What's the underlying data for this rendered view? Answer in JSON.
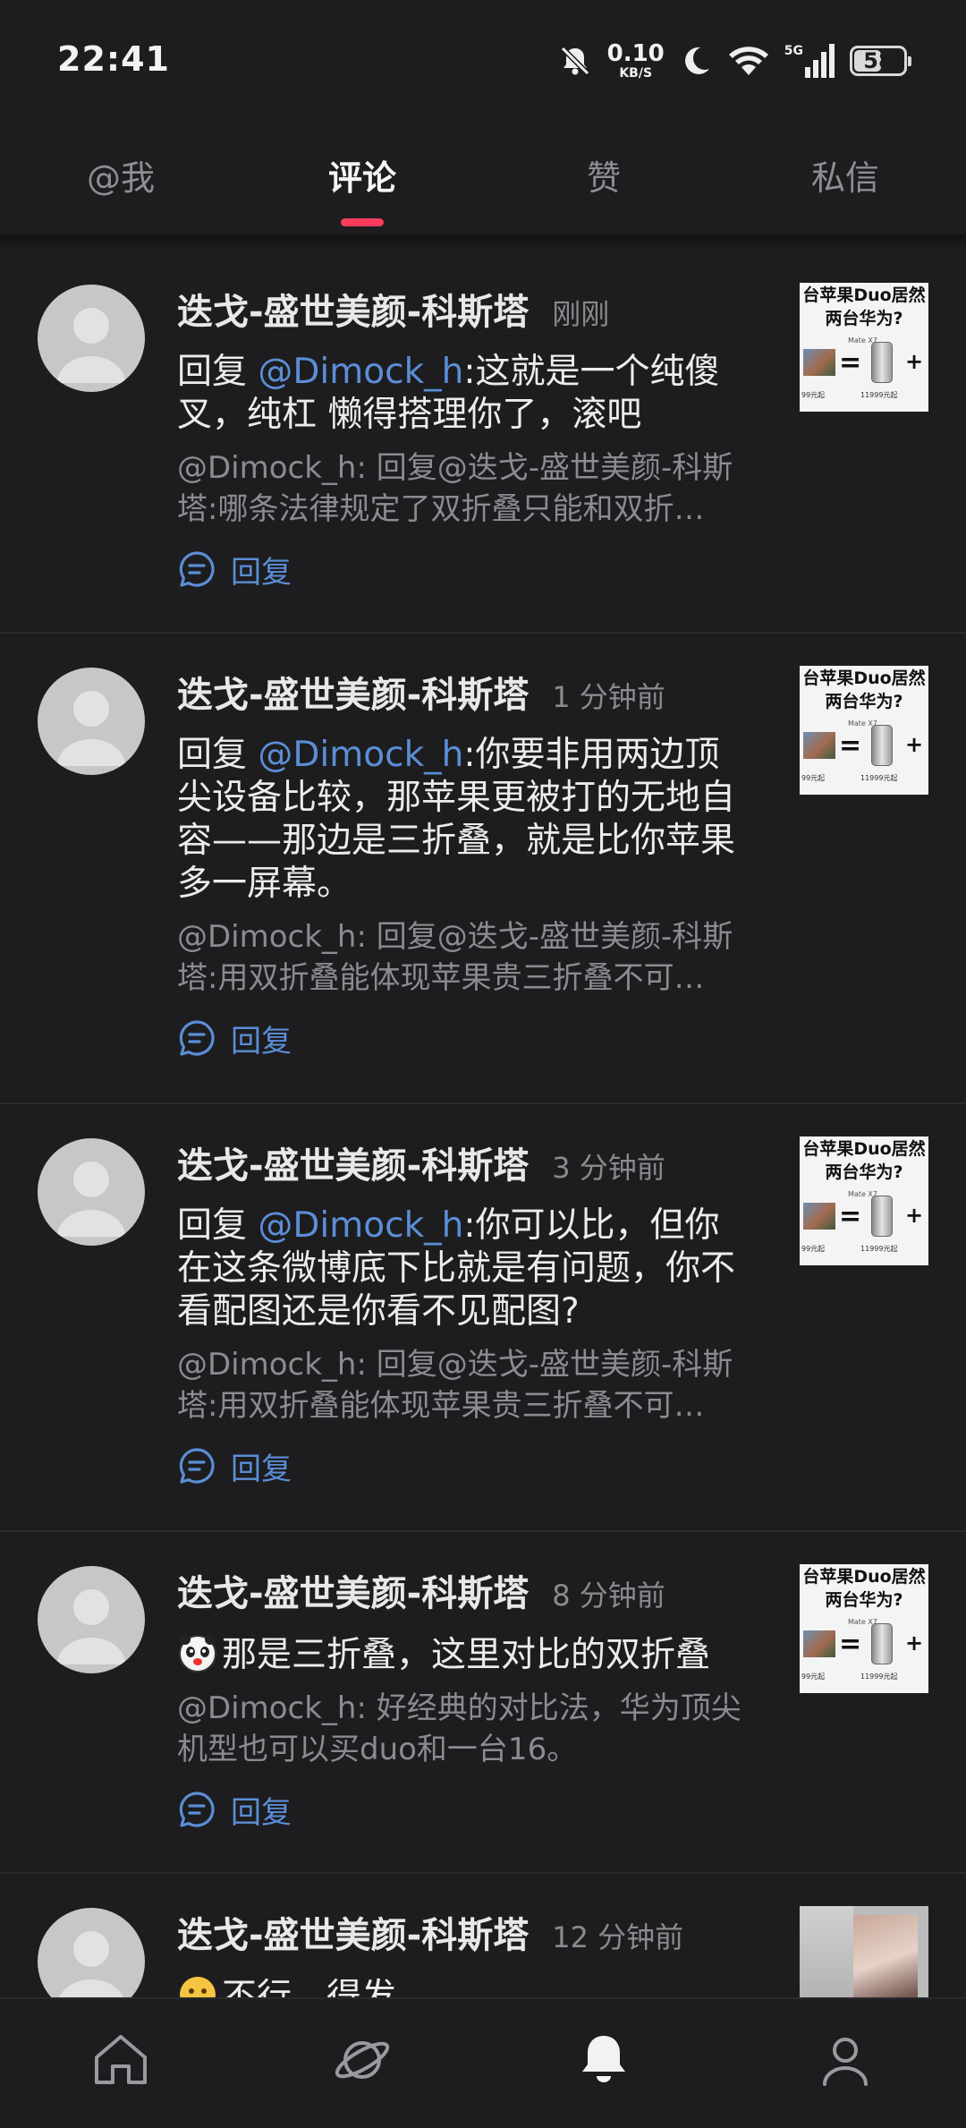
{
  "status_bar": {
    "time": "22:41",
    "net_speed_value": "0.10",
    "net_speed_unit": "KB/S",
    "signal_label": "5G",
    "battery": "58",
    "battery_level_percent": 58,
    "icons": [
      "mute-bell-icon",
      "moon-icon",
      "wifi-icon",
      "signal-icon",
      "battery-icon"
    ]
  },
  "tabs": [
    {
      "label": "@我",
      "active": false
    },
    {
      "label": "评论",
      "active": true
    },
    {
      "label": "赞",
      "active": false
    },
    {
      "label": "私信",
      "active": false
    }
  ],
  "colors": {
    "background": "#1d1d1f",
    "accent_indicator": "#ff3b5c",
    "link_blue": "#5b8ed6",
    "secondary_text": "#8b8b90"
  },
  "comments": [
    {
      "name": "迭戈-盛世美颜-科斯塔",
      "time": "刚刚",
      "reply_prefix": "回复 ",
      "mention": "@Dimock_h",
      "text": ":这就是一个纯傻叉，纯杠 懒得搭理你了，滚吧",
      "quote": "@Dimock_h: 回复@迭戈-盛世美颜-科斯塔:哪条法律规定了双折叠只能和双折…",
      "reply_label": "回复",
      "thumb_line1": "台苹果Duo居然",
      "thumb_line2": "两台华为?",
      "thumb_model": "Mate X7",
      "thumb_price1": "99元起",
      "thumb_price2": "11999元起"
    },
    {
      "name": "迭戈-盛世美颜-科斯塔",
      "time": "1 分钟前",
      "reply_prefix": "回复 ",
      "mention": "@Dimock_h",
      "text": ":你要非用两边顶尖设备比较，那苹果更被打的无地自容——那边是三折叠，就是比你苹果多一屏幕。",
      "quote": "@Dimock_h: 回复@迭戈-盛世美颜-科斯塔:用双折叠能体现苹果贵三折叠不可…",
      "reply_label": "回复",
      "thumb_line1": "台苹果Duo居然",
      "thumb_line2": "两台华为?",
      "thumb_model": "Mate X7",
      "thumb_price1": "99元起",
      "thumb_price2": "11999元起"
    },
    {
      "name": "迭戈-盛世美颜-科斯塔",
      "time": "3 分钟前",
      "reply_prefix": "回复 ",
      "mention": "@Dimock_h",
      "text": ":你可以比，但你在这条微博底下比就是有问题，你不看配图还是你看不见配图?",
      "quote": "@Dimock_h: 回复@迭戈-盛世美颜-科斯塔:用双折叠能体现苹果贵三折叠不可…",
      "reply_label": "回复",
      "thumb_line1": "台苹果Duo居然",
      "thumb_line2": "两台华为?",
      "thumb_model": "Mate X7",
      "thumb_price1": "99元起",
      "thumb_price2": "11999元起"
    },
    {
      "name": "迭戈-盛世美颜-科斯塔",
      "time": "8 分钟前",
      "emoji": "panda-emoji",
      "text": "那是三折叠，这里对比的双折叠",
      "quote": "@Dimock_h: 好经典的对比法，华为顶尖机型也可以买duo和一台16。",
      "reply_label": "回复",
      "thumb_line1": "台苹果Duo居然",
      "thumb_line2": "两台华为?",
      "thumb_model": "Mate X7",
      "thumb_price1": "99元起",
      "thumb_price2": "11999元起"
    },
    {
      "name": "迭戈-盛世美颜-科斯塔",
      "time": "12 分钟前",
      "emoji": "face-emoji",
      "text": "不行，得发"
    }
  ],
  "bottom_nav": [
    {
      "icon": "home-icon",
      "active": false
    },
    {
      "icon": "planet-icon",
      "active": false
    },
    {
      "icon": "bell-icon",
      "active": true
    },
    {
      "icon": "profile-icon",
      "active": false
    }
  ]
}
